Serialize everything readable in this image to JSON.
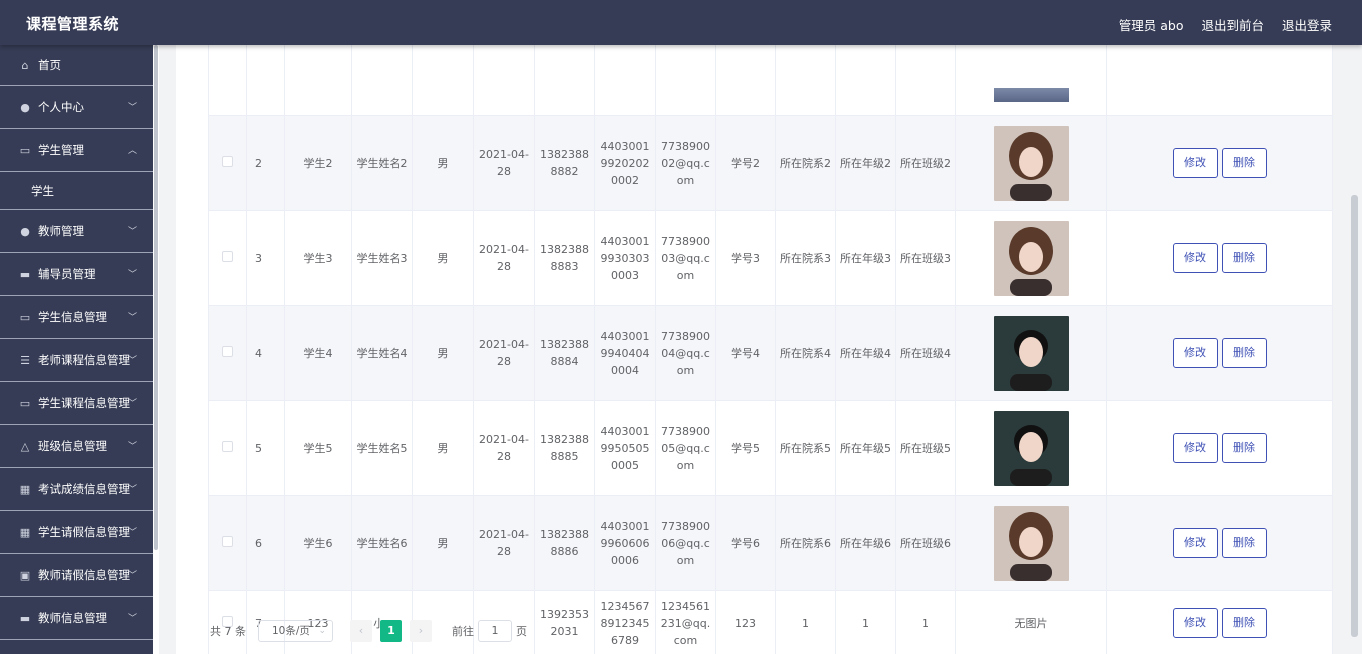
{
  "app": {
    "title": "课程管理系统"
  },
  "header": {
    "user": "管理员 abo",
    "to_front": "退出到前台",
    "logout": "退出登录"
  },
  "sidebar": {
    "items": [
      {
        "label": "首页",
        "icon": "home-icon"
      },
      {
        "label": "个人中心",
        "icon": "user-icon"
      },
      {
        "label": "学生管理",
        "icon": "id-card-icon",
        "expanded": true,
        "children": [
          "学生"
        ]
      },
      {
        "label": "教师管理",
        "icon": "user-icon"
      },
      {
        "label": "辅导员管理",
        "icon": "book-icon"
      },
      {
        "label": "学生信息管理",
        "icon": "monitor-icon"
      },
      {
        "label": "老师课程信息管理",
        "icon": "list-icon"
      },
      {
        "label": "学生课程信息管理",
        "icon": "monitor-icon"
      },
      {
        "label": "班级信息管理",
        "icon": "bell-icon"
      },
      {
        "label": "考试成绩信息管理",
        "icon": "grid-icon"
      },
      {
        "label": "学生请假信息管理",
        "icon": "table-icon"
      },
      {
        "label": "教师请假信息管理",
        "icon": "clipboard-icon"
      },
      {
        "label": "教师信息管理",
        "icon": "book-icon"
      }
    ]
  },
  "table": {
    "edit_label": "修改",
    "delete_label": "删除",
    "no_image_label": "无图片",
    "rows": [
      {
        "idx": "2",
        "username": "学生2",
        "name": "学生姓名2",
        "gender": "男",
        "date": "2021-04-28",
        "phone": "13823888882",
        "idcard": "440300199202020002",
        "email": "773890002@qq.com",
        "stuno": "学号2",
        "dept": "所在院系2",
        "grade": "所在年级2",
        "cls": "所在班级2",
        "photo": "photo-woman"
      },
      {
        "idx": "3",
        "username": "学生3",
        "name": "学生姓名3",
        "gender": "男",
        "date": "2021-04-28",
        "phone": "13823888883",
        "idcard": "440300199303030003",
        "email": "773890003@qq.com",
        "stuno": "学号3",
        "dept": "所在院系3",
        "grade": "所在年级3",
        "cls": "所在班级3",
        "photo": "photo-woman"
      },
      {
        "idx": "4",
        "username": "学生4",
        "name": "学生姓名4",
        "gender": "男",
        "date": "2021-04-28",
        "phone": "13823888884",
        "idcard": "440300199404040004",
        "email": "773890004@qq.com",
        "stuno": "学号4",
        "dept": "所在院系4",
        "grade": "所在年级4",
        "cls": "所在班级4",
        "photo": "photo-man"
      },
      {
        "idx": "5",
        "username": "学生5",
        "name": "学生姓名5",
        "gender": "男",
        "date": "2021-04-28",
        "phone": "13823888885",
        "idcard": "440300199505050005",
        "email": "773890005@qq.com",
        "stuno": "学号5",
        "dept": "所在院系5",
        "grade": "所在年级5",
        "cls": "所在班级5",
        "photo": "photo-man"
      },
      {
        "idx": "6",
        "username": "学生6",
        "name": "学生姓名6",
        "gender": "男",
        "date": "2021-04-28",
        "phone": "13823888886",
        "idcard": "440300199606060006",
        "email": "773890006@qq.com",
        "stuno": "学号6",
        "dept": "所在院系6",
        "grade": "所在年级6",
        "cls": "所在班级6",
        "photo": "photo-woman"
      },
      {
        "idx": "7",
        "username": "123",
        "name": "小v",
        "gender": "",
        "date": "",
        "phone": "13923532031",
        "idcard": "123456789123456789",
        "email": "1234561231@qq.com",
        "stuno": "123",
        "dept": "1",
        "grade": "1",
        "cls": "1",
        "photo": ""
      }
    ]
  },
  "pagination": {
    "total": "共 7 条",
    "page_size": "10条/页",
    "current_page": "1",
    "goto_label": "前往",
    "goto_value": "1",
    "page_unit": "页"
  }
}
